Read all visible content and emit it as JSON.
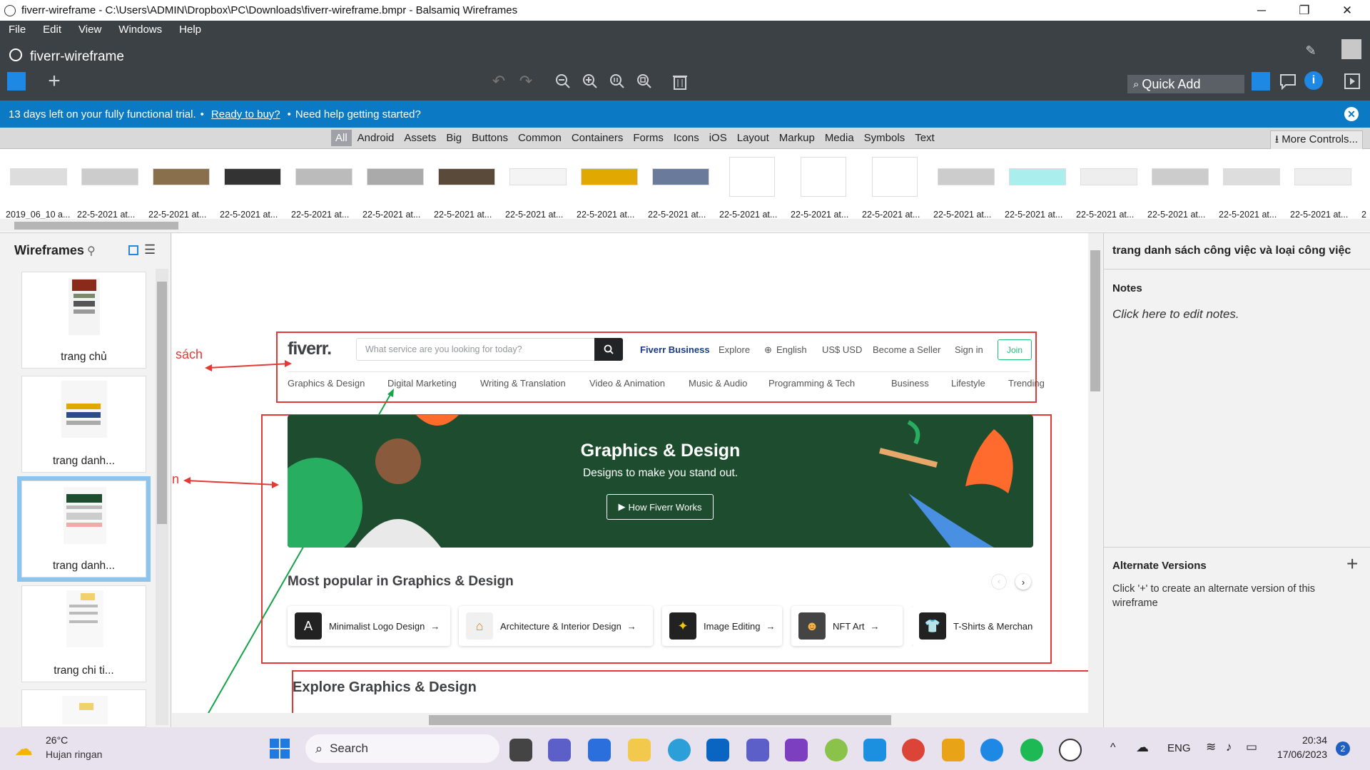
{
  "window": {
    "title": "fiverr-wireframe - C:\\Users\\ADMIN\\Dropbox\\PC\\Downloads\\fiverr-wireframe.bmpr - Balsamiq Wireframes",
    "minimize": "─",
    "maximize": "❐",
    "close": "✕"
  },
  "menu": [
    "File",
    "Edit",
    "View",
    "Windows",
    "Help"
  ],
  "app": {
    "doc_name": "fiverr-wireframe",
    "quick_add": "Quick Add"
  },
  "trial": {
    "text": "13 days left on your fully functional trial.",
    "bullet1": "•",
    "link": "Ready to buy?",
    "bullet2": "•",
    "help": "Need help getting started?"
  },
  "library_tabs": [
    "All",
    "Android",
    "Assets",
    "Big",
    "Buttons",
    "Common",
    "Containers",
    "Forms",
    "Icons",
    "iOS",
    "Layout",
    "Markup",
    "Media",
    "Symbols",
    "Text"
  ],
  "more_controls": "More Controls...",
  "thumbnails": [
    "2019_06_10 a...",
    "22-5-2021 at...",
    "22-5-2021 at...",
    "22-5-2021 at...",
    "22-5-2021 at...",
    "22-5-2021 at...",
    "22-5-2021 at...",
    "22-5-2021 at...",
    "22-5-2021 at...",
    "22-5-2021 at...",
    "22-5-2021 at...",
    "22-5-2021 at...",
    "22-5-2021 at...",
    "22-5-2021 at...",
    "22-5-2021 at...",
    "22-5-2021 at...",
    "22-5-2021 at...",
    "22-5-2021 at...",
    "22-5-2021 at..."
  ],
  "thumbnail_last_partial": "2",
  "left_panel": {
    "title": "Wireframes",
    "items": [
      "trang chủ",
      "trang danh...",
      "trang danh...",
      "trang chi ti..."
    ]
  },
  "canvas": {
    "note_left_1": "sách",
    "note_left_2": "n",
    "fiverr": {
      "logo": "fiverr.",
      "search_placeholder": "What service are you looking for today?",
      "nav": [
        "Fiverr Business",
        "Explore",
        "English",
        "US$ USD",
        "Become a Seller",
        "Sign in"
      ],
      "join": "Join",
      "categories": [
        "Graphics & Design",
        "Digital Marketing",
        "Writing & Translation",
        "Video & Animation",
        "Music & Audio",
        "Programming & Tech",
        "Business",
        "Lifestyle",
        "Trending"
      ]
    },
    "hero": {
      "title": "Graphics & Design",
      "subtitle": "Designs to make you stand out.",
      "button": "How Fiverr Works"
    },
    "popular": {
      "title": "Most popular in Graphics & Design",
      "cards": [
        "Minimalist Logo Design",
        "Architecture & Interior Design",
        "Image Editing",
        "NFT Art",
        "T-Shirts & Merchandi"
      ]
    },
    "explore_title": "Explore Graphics & Design"
  },
  "right_panel": {
    "title": "trang danh sách công việc và loại công việc",
    "notes_label": "Notes",
    "notes_placeholder": "Click here to edit notes.",
    "alt_label": "Alternate Versions",
    "alt_add": "+",
    "alt_desc": "Click '+' to create an alternate version of this wireframe"
  },
  "taskbar": {
    "temp": "26°C",
    "weather": "Hujan ringan",
    "search": "Search",
    "lang": "ENG",
    "time": "20:34",
    "date": "17/06/2023",
    "badge": "2"
  },
  "colors": {
    "app_dark": "#3c4146",
    "trial_blue": "#0b79c3",
    "hero_green": "#1d4d2e",
    "fiverr_green": "#1dbf73",
    "annotation_red": "#e53935"
  }
}
